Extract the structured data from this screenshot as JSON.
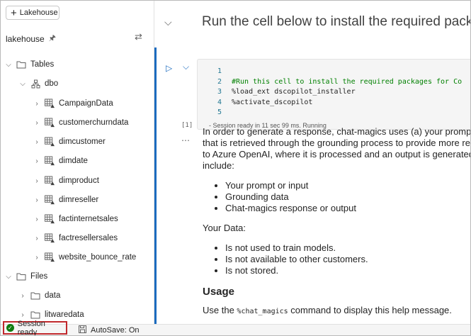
{
  "sidebar": {
    "add_button": "Lakehouse",
    "title": "lakehouse",
    "tree": {
      "tables": "Tables",
      "schema": "dbo",
      "items": [
        "CampaignData",
        "customerchurndata",
        "dimcustomer",
        "dimdate",
        "dimproduct",
        "dimreseller",
        "factinternetsales",
        "factresellersales",
        "website_bounce_rate"
      ],
      "files": "Files",
      "folders": [
        "data",
        "litwaredata"
      ]
    }
  },
  "notebook": {
    "heading": "Run the cell below to install the required pack",
    "cell": {
      "line_numbers": [
        "1",
        "2",
        "3",
        "4",
        "5"
      ],
      "lines": [
        "",
        "#Run this cell to install the required packages for Co",
        "%load_ext dscopilot_installer",
        "%activate_dscopilot",
        ""
      ],
      "status": "- Session ready in 11 sec 99 ms. Running",
      "exec_count": "[1]"
    },
    "markdown": {
      "para1_l1": "In order to generate a response, chat-magics uses (a) your prompt",
      "para1_l2": "that is retrieved through the grounding process to provide more re",
      "para1_l3": "to Azure OpenAI, where it is processed and an output is generated.",
      "para1_l4": "include:",
      "list1": [
        "Your prompt or input",
        "Grounding data",
        "Chat-magics response or output"
      ],
      "your_data": "Your Data:",
      "list2": [
        "Is not used to train models.",
        "Is not available to other customers.",
        "Is not stored."
      ],
      "usage_heading": "Usage",
      "usage_pre": "Use the ",
      "usage_code": "%chat_magics",
      "usage_post": " command to display this help message."
    }
  },
  "status_bar": {
    "session": "Session ready",
    "autosave": "AutoSave: On"
  },
  "colors": {
    "accent": "#1b6bbf",
    "success": "#107c10",
    "highlight_border": "#c0282c",
    "comment": "#008000"
  }
}
